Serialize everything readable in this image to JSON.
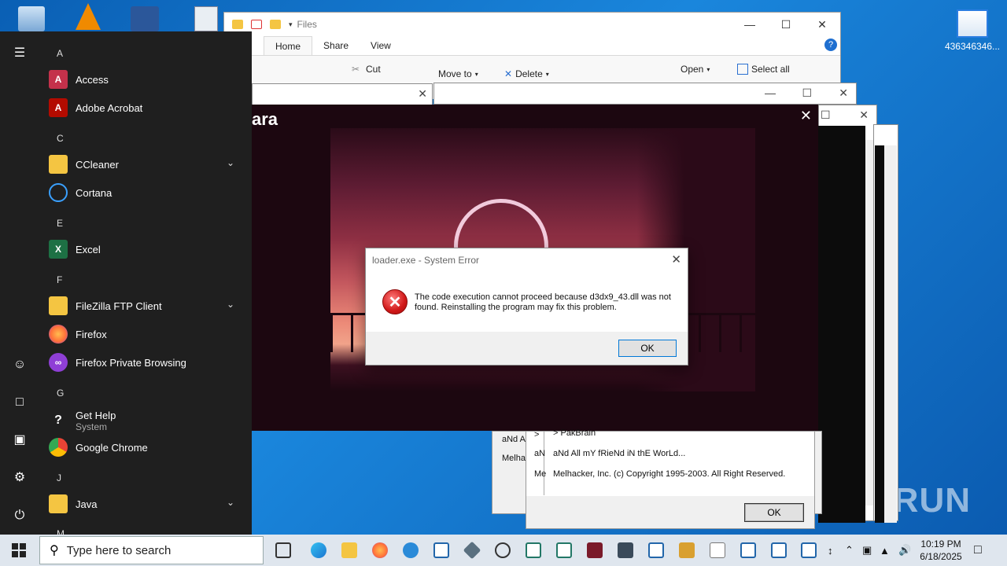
{
  "desktop": {
    "right_icon_label": "436346346...",
    "watermark": "ANY RUN"
  },
  "explorer": {
    "title": "Files",
    "tabs": [
      "Home",
      "Share",
      "View"
    ],
    "ribbon": {
      "cut": "Cut",
      "move_to": "Move to",
      "delete": "Delete",
      "open": "Open",
      "select_all": "Select all"
    }
  },
  "game": {
    "title_fragment": "ara"
  },
  "error_dialog": {
    "title": "loader.exe - System Error",
    "message": "The code execution cannot proceed because d3dx9_43.dll was not found. Reinstalling the program may fix this problem.",
    "ok": "OK"
  },
  "about_back": {
    "line1": "aNd A",
    "line2": "Melha"
  },
  "about_front": {
    "prompt": ">",
    "line_top": "> PakBrain",
    "line_friends": "aNd All mY fRieNd iN thE WorLd...",
    "copyright": "Melhacker, Inc. (c) Copyright 1995-2003. All Right Reserved.",
    "side1": "aN",
    "side2": "Me",
    "ok": "OK"
  },
  "start_menu": {
    "sections": [
      {
        "letter": "A",
        "apps": [
          {
            "label": "Access",
            "icon": "access-icon",
            "color": "#c4314b"
          },
          {
            "label": "Adobe Acrobat",
            "icon": "acrobat-icon",
            "color": "#b30b00"
          }
        ]
      },
      {
        "letter": "C",
        "apps": [
          {
            "label": "CCleaner",
            "icon": "folder-icon",
            "color": "#f4c542",
            "expand": true
          },
          {
            "label": "Cortana",
            "icon": "cortana-icon",
            "color": "#3aa0ff"
          }
        ]
      },
      {
        "letter": "E",
        "apps": [
          {
            "label": "Excel",
            "icon": "excel-icon",
            "color": "#1d7044"
          }
        ]
      },
      {
        "letter": "F",
        "apps": [
          {
            "label": "FileZilla FTP Client",
            "icon": "folder-icon",
            "color": "#f4c542",
            "expand": true
          },
          {
            "label": "Firefox",
            "icon": "firefox-icon",
            "color": "#ff7139"
          },
          {
            "label": "Firefox Private Browsing",
            "icon": "firefox-private-icon",
            "color": "#8f3fd6"
          }
        ]
      },
      {
        "letter": "G",
        "apps": [
          {
            "label": "Get Help",
            "sub": "System",
            "icon": "help-icon",
            "color": "#ffffff"
          },
          {
            "label": "Google Chrome",
            "icon": "chrome-icon",
            "color": "#34a853"
          }
        ]
      },
      {
        "letter": "J",
        "apps": [
          {
            "label": "Java",
            "icon": "folder-icon",
            "color": "#f4c542",
            "expand": true
          }
        ]
      },
      {
        "letter": "M",
        "apps": []
      }
    ]
  },
  "taskbar": {
    "search_placeholder": "Type here to search",
    "time": "10:19 PM",
    "date": "6/18/2025"
  }
}
